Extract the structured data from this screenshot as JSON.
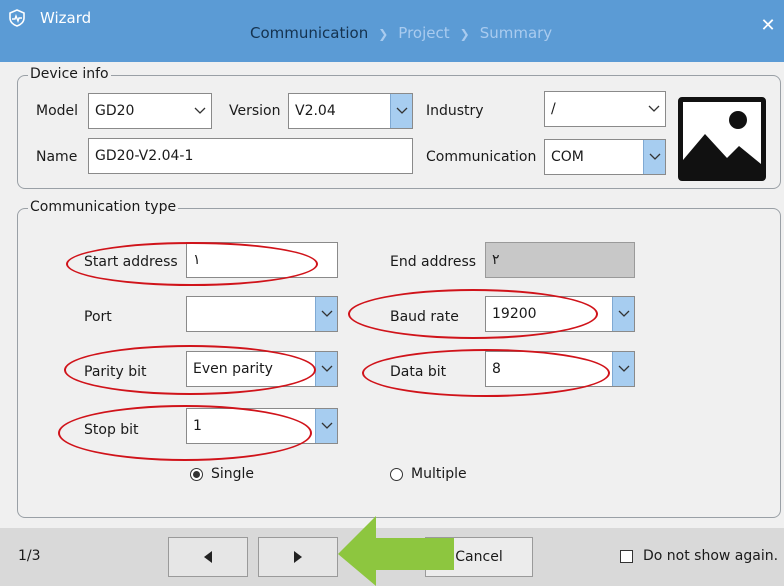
{
  "window": {
    "title": "Wizard",
    "steps": [
      "Communication",
      "Project",
      "Summary"
    ],
    "active_step": 0
  },
  "device_info": {
    "legend": "Device info",
    "model_label": "Model",
    "model_value": "GD20",
    "version_label": "Version",
    "version_value": "V2.04",
    "industry_label": "Industry",
    "industry_value": "/",
    "name_label": "Name",
    "name_value": "GD20-V2.04-1",
    "communication_label": "Communication",
    "communication_value": "COM"
  },
  "comm_type": {
    "legend": "Communication type",
    "start_address_label": "Start address",
    "start_address_value": "١",
    "end_address_label": "End address",
    "end_address_value": "٢",
    "port_label": "Port",
    "port_value": "",
    "baud_rate_label": "Baud rate",
    "baud_rate_value": "19200",
    "parity_label": "Parity bit",
    "parity_value": "Even parity",
    "data_bit_label": "Data bit",
    "data_bit_value": "8",
    "stop_bit_label": "Stop bit",
    "stop_bit_value": "1",
    "mode_single": "Single",
    "mode_multiple": "Multiple",
    "selected_mode": "single"
  },
  "footer": {
    "page_indicator": "1/3",
    "cancel_label": "Cancel",
    "dont_show_label": "Do not show again."
  },
  "colors": {
    "titlebar": "#5b9bd5",
    "annotation_oval": "#d0131a",
    "annotation_arrow": "#8dc63f",
    "dropdown_button": "#a7cdf0"
  }
}
